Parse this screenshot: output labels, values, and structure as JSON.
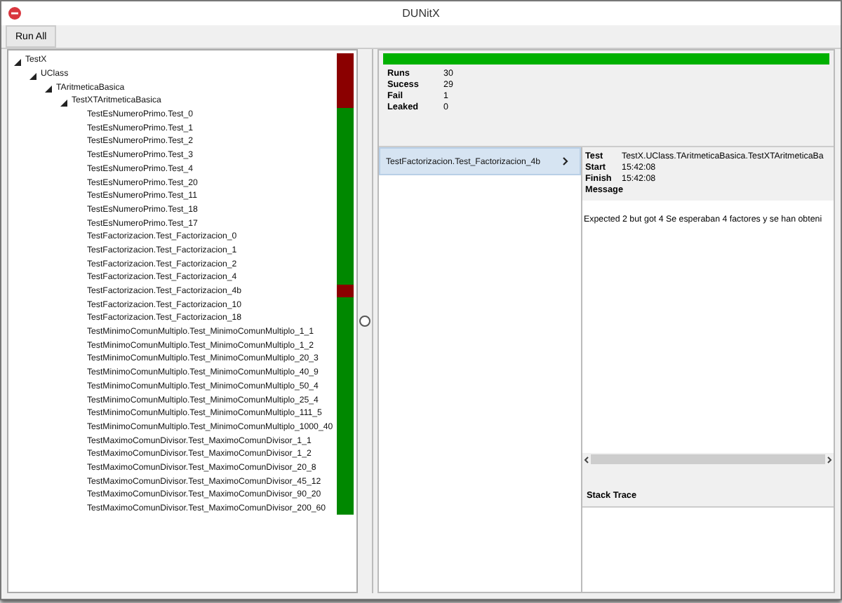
{
  "window": {
    "title": "DUNitX"
  },
  "toolbar": {
    "buttons": [
      "Run All"
    ]
  },
  "tree": [
    {
      "label": "TestX",
      "passed": false,
      "expanded": true,
      "children": [
        {
          "label": "UClass",
          "passed": false,
          "expanded": true,
          "children": [
            {
              "label": "TAritmeticaBasica",
              "passed": false,
              "expanded": true,
              "children": [
                {
                  "label": "TestXTAritmeticaBasica",
                  "passed": false,
                  "expanded": true,
                  "children": [
                    {
                      "label": "TestEsNumeroPrimo.Test_0",
                      "passed": true
                    },
                    {
                      "label": "TestEsNumeroPrimo.Test_1",
                      "passed": true
                    },
                    {
                      "label": "TestEsNumeroPrimo.Test_2",
                      "passed": true
                    },
                    {
                      "label": "TestEsNumeroPrimo.Test_3",
                      "passed": true
                    },
                    {
                      "label": "TestEsNumeroPrimo.Test_4",
                      "passed": true
                    },
                    {
                      "label": "TestEsNumeroPrimo.Test_20",
                      "passed": true
                    },
                    {
                      "label": "TestEsNumeroPrimo.Test_11",
                      "passed": true
                    },
                    {
                      "label": "TestEsNumeroPrimo.Test_18",
                      "passed": true
                    },
                    {
                      "label": "TestEsNumeroPrimo.Test_17",
                      "passed": true
                    },
                    {
                      "label": "TestFactorizacion.Test_Factorizacion_0",
                      "passed": true
                    },
                    {
                      "label": "TestFactorizacion.Test_Factorizacion_1",
                      "passed": true
                    },
                    {
                      "label": "TestFactorizacion.Test_Factorizacion_2",
                      "passed": true
                    },
                    {
                      "label": "TestFactorizacion.Test_Factorizacion_4",
                      "passed": true
                    },
                    {
                      "label": "TestFactorizacion.Test_Factorizacion_4b",
                      "passed": false
                    },
                    {
                      "label": "TestFactorizacion.Test_Factorizacion_10",
                      "passed": true
                    },
                    {
                      "label": "TestFactorizacion.Test_Factorizacion_18",
                      "passed": true
                    },
                    {
                      "label": "TestMinimoComunMultiplo.Test_MinimoComunMultiplo_1_1",
                      "passed": true
                    },
                    {
                      "label": "TestMinimoComunMultiplo.Test_MinimoComunMultiplo_1_2",
                      "passed": true
                    },
                    {
                      "label": "TestMinimoComunMultiplo.Test_MinimoComunMultiplo_20_3",
                      "passed": true
                    },
                    {
                      "label": "TestMinimoComunMultiplo.Test_MinimoComunMultiplo_40_9",
                      "passed": true
                    },
                    {
                      "label": "TestMinimoComunMultiplo.Test_MinimoComunMultiplo_50_4",
                      "passed": true
                    },
                    {
                      "label": "TestMinimoComunMultiplo.Test_MinimoComunMultiplo_25_4",
                      "passed": true
                    },
                    {
                      "label": "TestMinimoComunMultiplo.Test_MinimoComunMultiplo_111_5",
                      "passed": true
                    },
                    {
                      "label": "TestMinimoComunMultiplo.Test_MinimoComunMultiplo_1000_40",
                      "passed": true
                    },
                    {
                      "label": "TestMaximoComunDivisor.Test_MaximoComunDivisor_1_1",
                      "passed": true
                    },
                    {
                      "label": "TestMaximoComunDivisor.Test_MaximoComunDivisor_1_2",
                      "passed": true
                    },
                    {
                      "label": "TestMaximoComunDivisor.Test_MaximoComunDivisor_20_8",
                      "passed": true
                    },
                    {
                      "label": "TestMaximoComunDivisor.Test_MaximoComunDivisor_45_12",
                      "passed": true
                    },
                    {
                      "label": "TestMaximoComunDivisor.Test_MaximoComunDivisor_90_20",
                      "passed": true
                    },
                    {
                      "label": "TestMaximoComunDivisor.Test_MaximoComunDivisor_200_60",
                      "passed": true
                    }
                  ]
                }
              ]
            }
          ]
        }
      ]
    }
  ],
  "summary": {
    "level": 1,
    "stats": [
      {
        "label": "Runs",
        "value": "30"
      },
      {
        "label": "Sucess",
        "value": "29"
      },
      {
        "label": "Fail",
        "value": "1"
      },
      {
        "label": "Leaked",
        "value": "0"
      }
    ]
  },
  "failures": [
    {
      "label": "TestFactorizacion.Test_Factorizacion_4b",
      "selected": true
    }
  ],
  "details": {
    "fields": [
      {
        "label": "Test",
        "value": "TestX.UClass.TAritmeticaBasica.TestXTAritmeticaBa"
      },
      {
        "label": "Start",
        "value": "15:42:08"
      },
      {
        "label": "Finish",
        "value": "15:42:08"
      },
      {
        "label": "Message"
      }
    ],
    "message": "Expected 2 but got 4 Se esperaban 4 factores y se han obteni",
    "stack_trace_title": "Stack Trace"
  }
}
